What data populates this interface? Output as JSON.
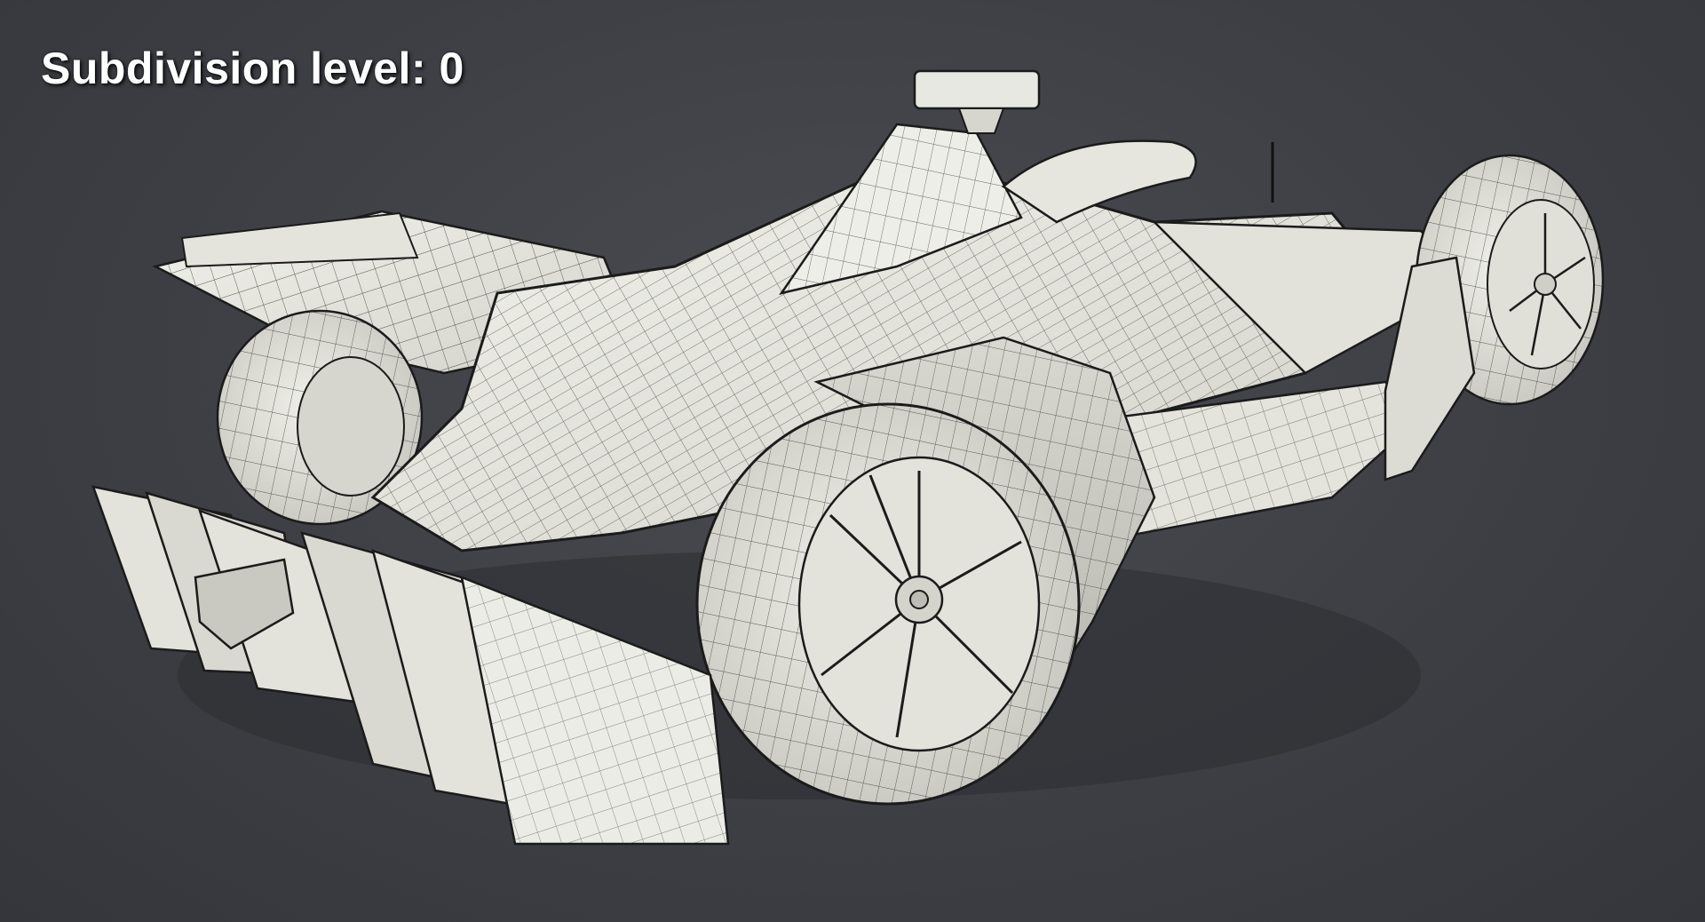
{
  "overlay": {
    "label_text": "Subdivision level: 0"
  },
  "scene": {
    "subject": "formula-e-race-car-wireframe",
    "background_color": "#3d3f45",
    "surface_color": "#e9e9e2",
    "wire_color": "#1e1e1e",
    "shadow_color": "#2a2b2f"
  }
}
